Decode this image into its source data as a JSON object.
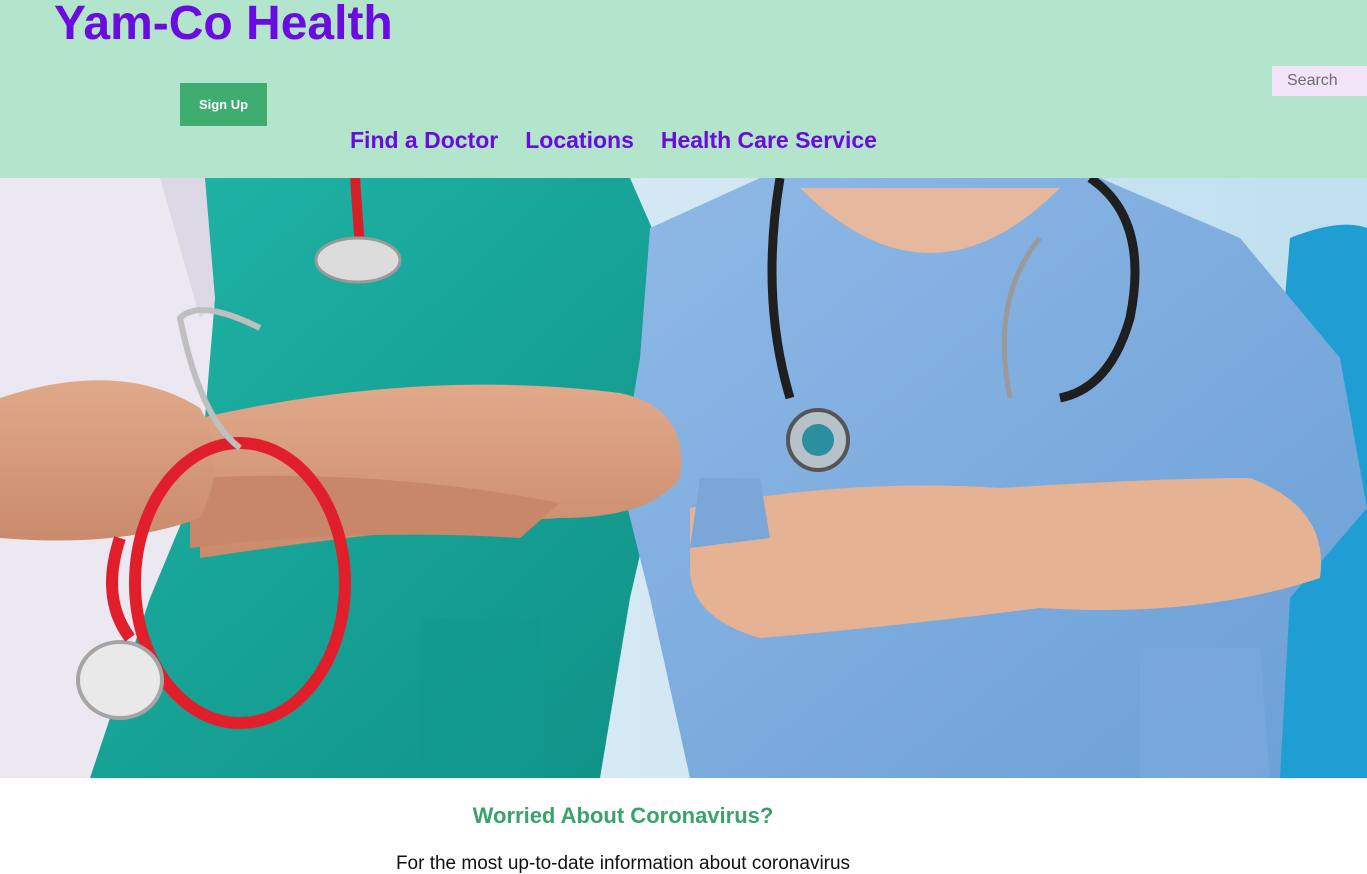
{
  "header": {
    "brand": "Yam-Co Health",
    "signup_label": "Sign Up",
    "search_placeholder": "Search",
    "nav": [
      "Find a Doctor",
      "Locations",
      "Health Care Service"
    ]
  },
  "hero": {
    "image_alt": "Medical staff with stethoscopes, arms crossed"
  },
  "promo": {
    "title": "Worried About Coronavirus?",
    "text": "For the most up-to-date information about coronavirus"
  },
  "colors": {
    "header_bg": "#b3e5cd",
    "brand": "#6a0be0",
    "button": "#3fad6f",
    "promo_title": "#3aa36a",
    "search_bg": "#f1e3f8"
  }
}
